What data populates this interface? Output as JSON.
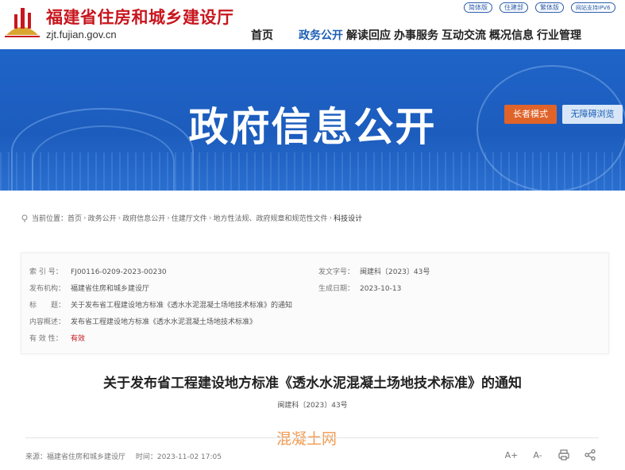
{
  "header": {
    "site_title": "福建省住房和城乡建设厅",
    "domain": "zjt.fujian.gov.cn",
    "top_links": [
      "简体版",
      "住建部",
      "繁体版",
      "网站支持IPV6"
    ],
    "nav": [
      "首页",
      "政务公开",
      "解读回应",
      "办事服务",
      "互动交流",
      "概况信息",
      "行业管理"
    ],
    "active_nav": "政务公开"
  },
  "banner": {
    "title": "政府信息公开",
    "elder_mode": "长者模式",
    "accessible": "无障碍浏览"
  },
  "breadcrumb": [
    "当前位置：首页",
    "政务公开",
    "政府信息公开",
    "住建厅文件",
    "地方性法规、政府规章和规范性文件",
    "科技设计"
  ],
  "info": {
    "index_label": "索 引 号：",
    "index_value": "FJ00116-0209-2023-00230",
    "docno_label": "发文字号：",
    "docno_value": "闽建科〔2023〕43号",
    "org_label": "发布机构：",
    "org_value": "福建省住房和城乡建设厅",
    "date_label": "生成日期：",
    "date_value": "2023-10-13",
    "title_label": "标　　题：",
    "title_value": "关于发布省工程建设地方标准《透水水泥混凝土场地技术标准》的通知",
    "summary_label": "内容概述：",
    "summary_value": "发布省工程建设地方标准《透水水泥混凝土场地技术标准》",
    "validity_label": "有 效 性：",
    "validity_value": "有效"
  },
  "article": {
    "title": "关于发布省工程建设地方标准《透水水泥混凝土场地技术标准》的通知",
    "doc_number": "闽建科〔2023〕43号",
    "source": "来源：福建省住房和城乡建设厅",
    "time": "时间：2023-11-02 17:05",
    "watermark": "混凝土网"
  },
  "tools": [
    "A+",
    "A-"
  ]
}
